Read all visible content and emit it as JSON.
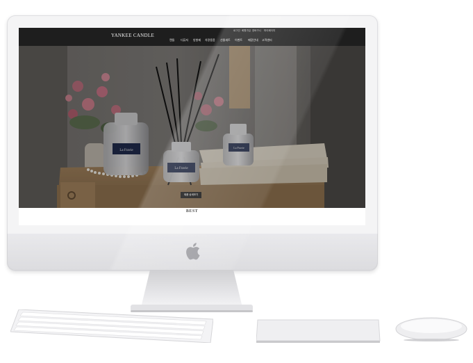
{
  "site": {
    "logo": "YANKEE CANDLE",
    "utility_links": [
      "로그인",
      "회원가입",
      "장바구니",
      "마이페이지"
    ],
    "nav_items": [
      "캔들",
      "디퓨저",
      "방향제",
      "차량용품",
      "선물세트",
      "이벤트",
      "매장안내",
      "고객센터"
    ],
    "hero_label": "La Fravie",
    "cta_label": "제품 상세보기",
    "section_title": "BEST"
  },
  "colors": {
    "topbar": "#1e1e1e",
    "hero_bg": "#5d5a56",
    "table_wood": "#b9956b",
    "bezel": "#f4f4f5"
  }
}
